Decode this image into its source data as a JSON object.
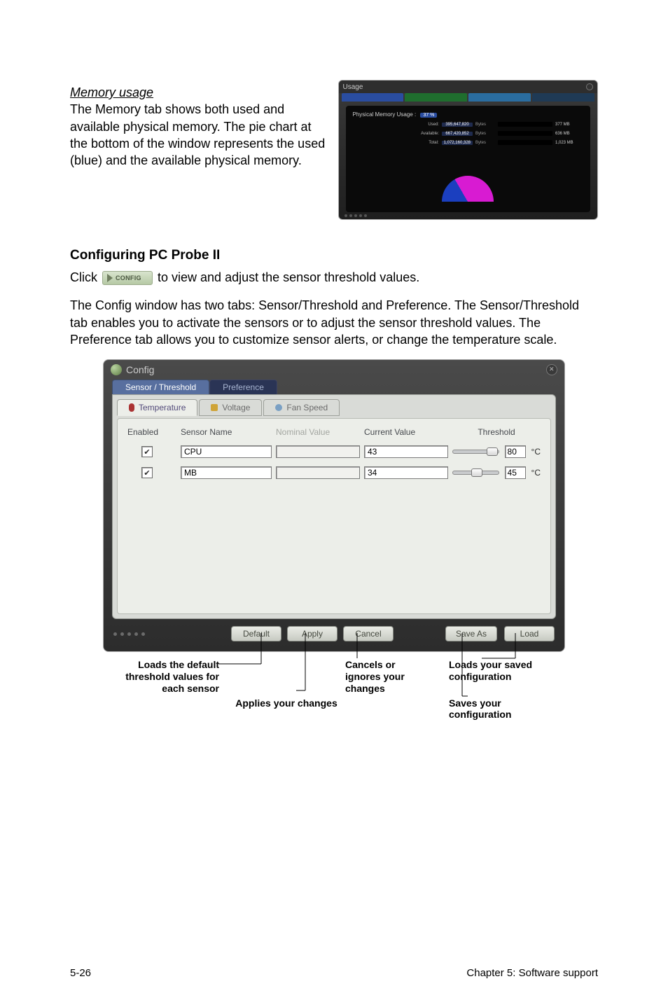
{
  "memory": {
    "title": "Memory usage",
    "body": "The Memory tab shows both used and available physical memory. The pie chart at the bottom of the window represents the used (blue) and the available physical memory.",
    "figTitle": "Usage",
    "pmuLabel": "Physical Memory Usage :",
    "pmuPct": "37 %",
    "rows": [
      {
        "label": "Used:",
        "num": "395,647,820",
        "bytes": "Bytes",
        "barPct": 37,
        "end": "377 MB"
      },
      {
        "label": "Available:",
        "num": "667,420,852",
        "bytes": "Bytes",
        "barPct": 63,
        "end": "636 MB"
      },
      {
        "label": "Total:",
        "num": "1,072,160,328",
        "bytes": "Bytes",
        "barPct": 100,
        "end": "1,023 MB"
      }
    ]
  },
  "configTitle": "Configuring PC Probe II",
  "clickLine_a": "Click ",
  "clickLine_b": " to view and adjust the sensor threshold values.",
  "configBtnLabel": "CONFIG",
  "paragraph": "The Config window has two tabs: Sensor/Threshold and Preference. The Sensor/Threshold tab enables you to activate the sensors or to adjust the sensor threshold values. The Preference tab allows you to customize sensor alerts, or change the temperature scale.",
  "configWindow": {
    "title": "Config",
    "tab_sensor": "Sensor / Threshold",
    "tab_pref": "Preference",
    "sub_temp": "Temperature",
    "sub_volt": "Voltage",
    "sub_fan": "Fan Speed",
    "col_enabled": "Enabled",
    "col_sensor": "Sensor Name",
    "col_nominal": "Nominal Value",
    "col_current": "Current Value",
    "col_threshold": "Threshold",
    "rows": [
      {
        "enabled": true,
        "name": "CPU",
        "nominal": "",
        "current": "43",
        "threshold": "80",
        "unit": "C",
        "knob": 74
      },
      {
        "enabled": true,
        "name": "MB",
        "nominal": "",
        "current": "34",
        "threshold": "45",
        "unit": "C",
        "knob": 40
      }
    ],
    "btn_default": "Default",
    "btn_apply": "Apply",
    "btn_cancel": "Cancel",
    "btn_saveas": "Save As",
    "btn_load": "Load"
  },
  "captions": {
    "loadsDefault": "Loads the default threshold values for each sensor",
    "applies": "Applies your changes",
    "cancels": "Cancels or ignores your changes",
    "loadsSaved": "Loads your saved configuration",
    "saves": "Saves your configuration"
  },
  "footer": {
    "left": "5-26",
    "right": "Chapter 5: Software support"
  }
}
